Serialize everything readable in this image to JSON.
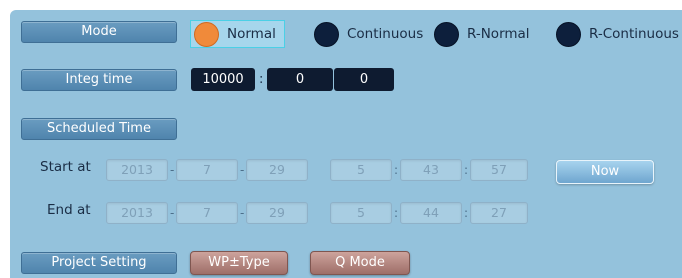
{
  "mode": {
    "label": "Mode",
    "selected": "Normal",
    "options": [
      {
        "label": "Normal",
        "selected": true
      },
      {
        "label": "Continuous",
        "selected": false
      },
      {
        "label": "R-Normal",
        "selected": false
      },
      {
        "label": "R-Continuous",
        "selected": false
      }
    ]
  },
  "integ_time": {
    "label": "Integ time",
    "values": [
      "10000",
      "0",
      "0"
    ],
    "separator": ":"
  },
  "scheduled_time": {
    "label": "Scheduled Time",
    "start": {
      "label": "Start at",
      "date": [
        "2013",
        "7",
        "29"
      ],
      "time": [
        "5",
        "43",
        "57"
      ]
    },
    "end": {
      "label": "End at",
      "date": [
        "2013",
        "7",
        "29"
      ],
      "time": [
        "5",
        "44",
        "27"
      ]
    },
    "date_sep": "-",
    "time_sep": ":",
    "now_button": "Now"
  },
  "project_setting": {
    "label": "Project Setting",
    "buttons": [
      "WP±Type",
      "Q Mode"
    ]
  },
  "colors": {
    "panel_bg": "#94c2dc",
    "radio_on": "#f08a3a",
    "radio_off": "#0d1f3c",
    "dark_field": "#0e1b30"
  }
}
